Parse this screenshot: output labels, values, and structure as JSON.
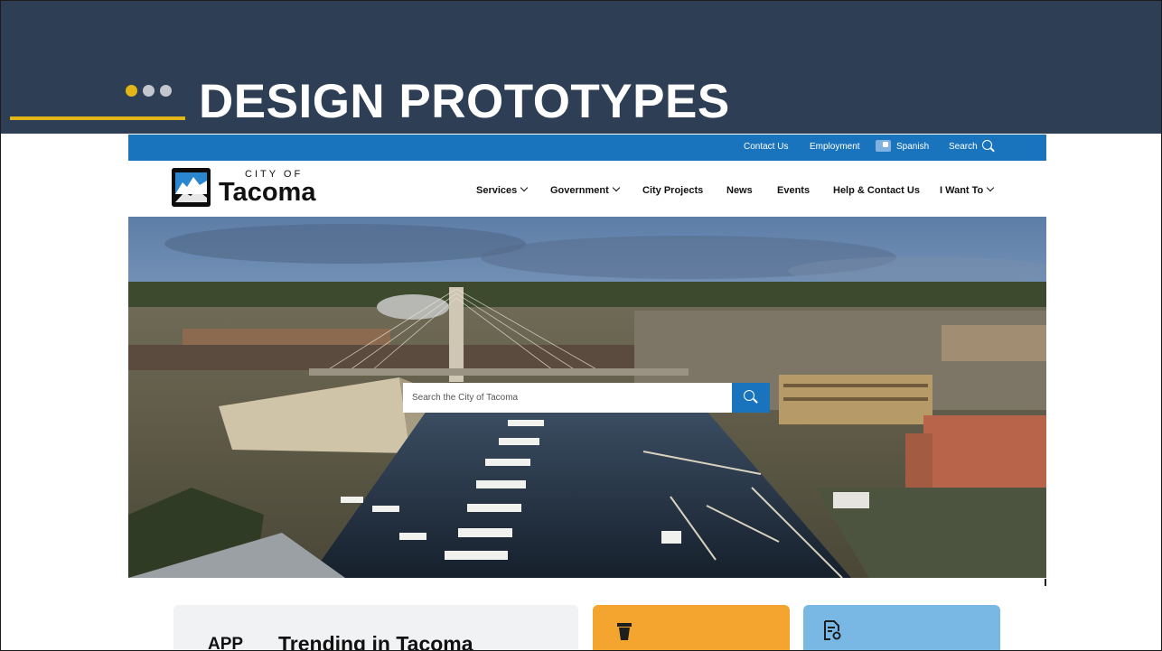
{
  "slide": {
    "title": "DESIGN PROTOTYPES",
    "colors": {
      "header_bg": "#2e3e55",
      "accent_gold": "#e3b617",
      "dot_gray": "#c3c7ce"
    }
  },
  "utility_bar": {
    "contact": "Contact Us",
    "employment": "Employment",
    "language": "Spanish",
    "search": "Search",
    "icons": [
      "translate-icon",
      "search-icon"
    ],
    "color": "#1a74bd"
  },
  "logo": {
    "city_of": "CITY OF",
    "name": "Tacoma"
  },
  "nav": {
    "services": "Services",
    "government": "Government",
    "city_projects": "City Projects",
    "news": "News",
    "events": "Events",
    "help": "Help & Contact Us",
    "i_want_to": "I Want To"
  },
  "hero": {
    "search_placeholder": "Search the City of Tacoma"
  },
  "cards": {
    "trending_prefix": "APP",
    "trending_title": "Trending in Tacoma",
    "orange_icon": "cup-icon",
    "blue_icon": "document-icon",
    "colors": {
      "trending": "#f1f2f3",
      "orange": "#f3a52f",
      "blue": "#79b8e4"
    }
  }
}
